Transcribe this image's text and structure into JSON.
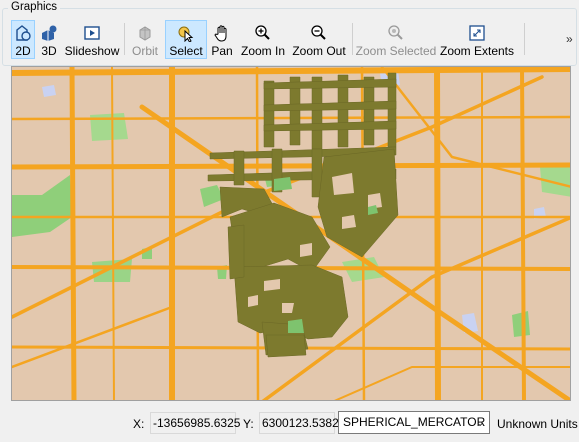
{
  "group": {
    "title": "Graphics"
  },
  "toolbar": {
    "buttons": [
      {
        "label": "2D",
        "icon": "view-2d-icon",
        "state": "active"
      },
      {
        "label": "3D",
        "icon": "view-3d-icon",
        "state": "normal"
      },
      {
        "label": "Slideshow",
        "icon": "slideshow-icon",
        "state": "normal"
      },
      {
        "label": "Orbit",
        "icon": "orbit-icon",
        "state": "disabled"
      },
      {
        "label": "Select",
        "icon": "select-cursor-icon",
        "state": "active"
      },
      {
        "label": "Pan",
        "icon": "pan-hand-icon",
        "state": "normal"
      },
      {
        "label": "Zoom In",
        "icon": "zoom-in-icon",
        "state": "normal"
      },
      {
        "label": "Zoom Out",
        "icon": "zoom-out-icon",
        "state": "normal"
      },
      {
        "label": "Zoom Selected",
        "icon": "zoom-selected-icon",
        "state": "disabled"
      },
      {
        "label": "Zoom Extents",
        "icon": "zoom-extents-icon",
        "state": "normal"
      }
    ],
    "overflow": "»"
  },
  "map": {
    "basemap_colors": {
      "land": "#e3c8ae",
      "road": "#f4a521",
      "park": "#8fcf7a",
      "water": "#c9d2f2"
    },
    "feature_color": "#7d7a2e"
  },
  "status": {
    "x_label": "X:",
    "x_value": "-13656985.6325",
    "y_label": "Y:",
    "y_value": "6300123.5382",
    "projection": "SPHERICAL_MERCATOR",
    "units": "Unknown Units"
  }
}
